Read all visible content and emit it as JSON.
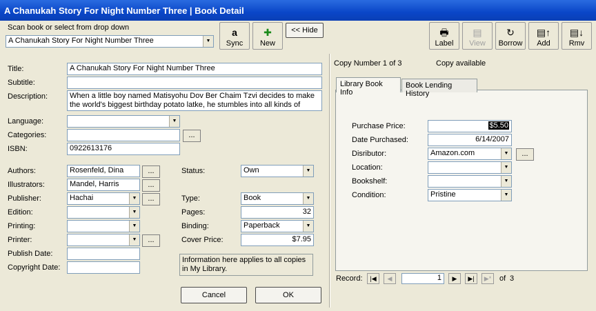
{
  "window": {
    "title": "A Chanukah Story For Night Number Three | Book Detail"
  },
  "scan": {
    "label": "Scan book or select from drop down",
    "value": "A Chanukah Story For Night Number Three"
  },
  "toolbar": {
    "sync": "Sync",
    "new": "New",
    "hide": "<< Hide",
    "label": "Label",
    "view": "View",
    "borrow": "Borrow",
    "add": "Add",
    "rmv": "Rmv"
  },
  "book": {
    "title_label": "Title:",
    "title": "A Chanukah Story For Night Number Three",
    "subtitle_label": "Subtitle:",
    "subtitle": "",
    "description_label": "Description:",
    "description": "When a little boy named Matisyohu Dov Ber Chaim Tzvi decides to make the world's biggest birthday potato latke, he stumbles into all kinds of",
    "language_label": "Language:",
    "language": "",
    "categories_label": "Categories:",
    "categories": "",
    "isbn_label": "ISBN:",
    "isbn": "0922613176",
    "authors_label": "Authors:",
    "authors": "Rosenfeld, Dina",
    "illustrators_label": "Illustrators:",
    "illustrators": "Mandel, Harris",
    "publisher_label": "Publisher:",
    "publisher": "Hachai",
    "edition_label": "Edition:",
    "edition": "",
    "printing_label": "Printing:",
    "printing": "",
    "printer_label": "Printer:",
    "printer": "",
    "publish_date_label": "Publish Date:",
    "publish_date": "",
    "copyright_date_label": "Copyright Date:",
    "copyright_date": "",
    "status_label": "Status:",
    "status": "Own",
    "type_label": "Type:",
    "type": "Book",
    "pages_label": "Pages:",
    "pages": "32",
    "binding_label": "Binding:",
    "binding": "Paperback",
    "cover_price_label": "Cover Price:",
    "cover_price": "$7.95",
    "note": "Information here applies to all copies in My Library."
  },
  "buttons": {
    "cancel": "Cancel",
    "ok": "OK",
    "ellipsis": "..."
  },
  "copy": {
    "number": "Copy Number 1 of 3",
    "availability": "Copy available",
    "tab_info": "Library Book Info",
    "tab_history": "Book Lending History",
    "purchase_price_label": "Purchase Price:",
    "purchase_price": "$5.50",
    "date_purchased_label": "Date Purchased:",
    "date_purchased": "6/14/2007",
    "distributor_label": "Disributor:",
    "distributor": "Amazon.com",
    "location_label": "Location:",
    "location": "",
    "bookshelf_label": "Bookshelf:",
    "bookshelf": "",
    "condition_label": "Condition:",
    "condition": "Pristine"
  },
  "record_nav": {
    "label": "Record:",
    "current": "1",
    "of_label": "of",
    "total": "3"
  },
  "colors": {
    "titlebar": "#0a46c8",
    "window_bg": "#ece9d8",
    "highlight": "#000000"
  }
}
